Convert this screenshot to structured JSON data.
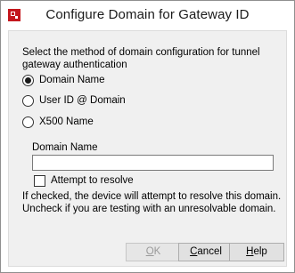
{
  "window": {
    "title": "Configure Domain for Gateway ID",
    "icon": "firebox-red-icon"
  },
  "form": {
    "prompt": "Select the method of domain configuration for tunnel gateway authentication",
    "options": [
      {
        "label": "Domain Name",
        "selected": true
      },
      {
        "label": "User ID @ Domain",
        "selected": false
      },
      {
        "label": "X500 Name",
        "selected": false
      }
    ],
    "domain_name_label": "Domain Name",
    "domain_name_value": "",
    "attempt_resolve_label": "Attempt to resolve",
    "attempt_resolve_checked": false,
    "help_text": "If checked, the device will attempt to resolve this domain. Uncheck if you are testing with an unresolvable domain."
  },
  "buttons": {
    "ok_mnemonic": "O",
    "ok_rest": "K",
    "ok_enabled": false,
    "cancel_mnemonic": "C",
    "cancel_rest": "ancel",
    "help_mnemonic": "H",
    "help_rest": "elp"
  },
  "colors": {
    "icon_red": "#c4171d",
    "client_bg": "#f0f0f0"
  }
}
